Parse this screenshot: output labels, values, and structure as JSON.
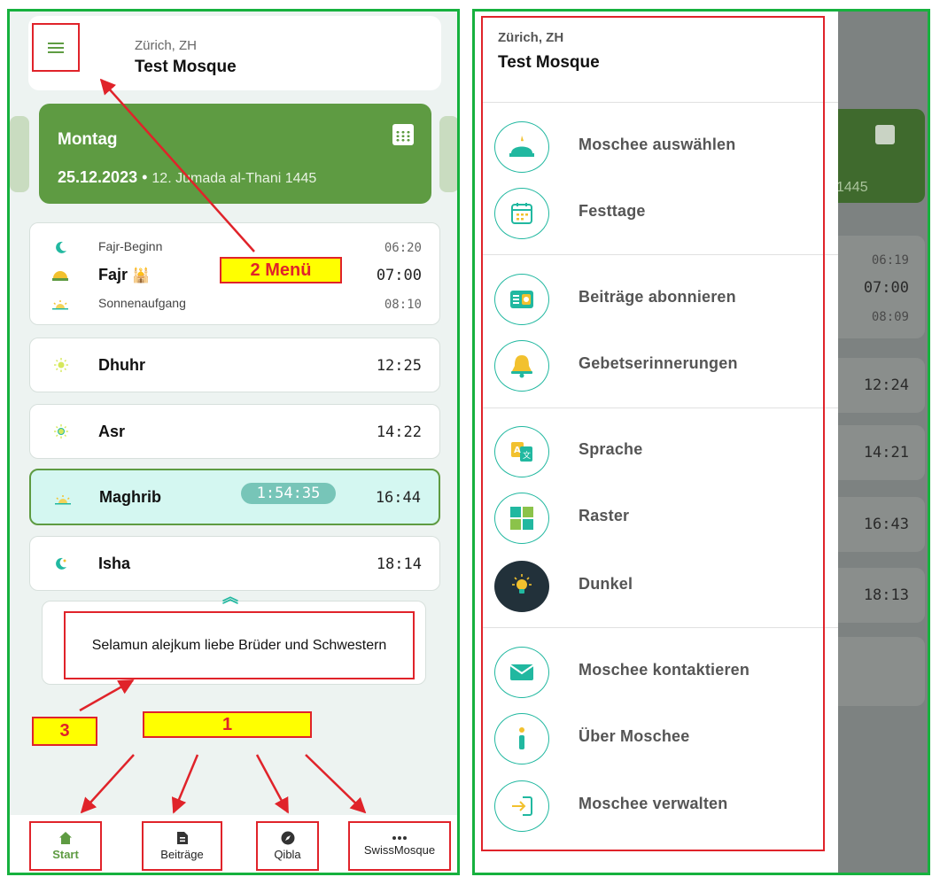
{
  "left": {
    "header": {
      "city": "Zürich, ZH",
      "mosque": "Test Mosque"
    },
    "date": {
      "day": "Montag",
      "gregorian": "25.12.2023",
      "separator": " • ",
      "hijri": "12. Jumada al-Thani 1445"
    },
    "fajr": {
      "begin_label": "Fajr-Beginn",
      "begin_time": "06:20",
      "name": "Fajr",
      "time": "07:00",
      "sunrise_label": "Sonnenaufgang",
      "sunrise_time": "08:10"
    },
    "prayers": [
      {
        "name": "Dhuhr",
        "time": "12:25",
        "icon": "sun-icon"
      },
      {
        "name": "Asr",
        "time": "14:22",
        "icon": "sun-icon"
      },
      {
        "name": "Maghrib",
        "time": "16:44",
        "icon": "sunset-icon",
        "countdown": "1:54:35",
        "active": true
      },
      {
        "name": "Isha",
        "time": "18:14",
        "icon": "moon-icon"
      }
    ],
    "chevron": "︽",
    "message": "Selamun alejkum liebe Brüder und Schwestern",
    "nav": [
      {
        "label": "Start",
        "icon": "home-icon",
        "active": true
      },
      {
        "label": "Beiträge",
        "icon": "document-icon"
      },
      {
        "label": "Qibla",
        "icon": "compass-icon"
      },
      {
        "label": "SwissMosque",
        "icon": "more-icon"
      }
    ]
  },
  "callouts": {
    "menu": "2 Menü",
    "nav": "1",
    "message": "3"
  },
  "right": {
    "drawer": {
      "city": "Zürich, ZH",
      "mosque": "Test Mosque",
      "items": [
        {
          "label": "Moschee auswählen",
          "icon": "mosque-icon"
        },
        {
          "label": "Festtage",
          "icon": "calendar-icon"
        },
        {
          "label": "Beiträge abonnieren",
          "icon": "subscribe-icon"
        },
        {
          "label": "Gebetserinnerungen",
          "icon": "bell-icon"
        },
        {
          "label": "Sprache",
          "icon": "translate-icon"
        },
        {
          "label": "Raster",
          "icon": "grid-icon"
        },
        {
          "label": "Dunkel",
          "icon": "lightbulb-icon"
        },
        {
          "label": "Moschee kontaktieren",
          "icon": "mail-icon"
        },
        {
          "label": "Über Moschee",
          "icon": "info-icon"
        },
        {
          "label": "Moschee verwalten",
          "icon": "login-icon"
        }
      ]
    },
    "background": {
      "hijri_fragment": "1445",
      "times": [
        "06:19",
        "07:00",
        "08:09",
        "12:24",
        "14:21",
        "16:43",
        "18:13"
      ]
    }
  },
  "colors": {
    "primary_green": "#5e9b42",
    "teal": "#21b8a0",
    "highlight_bg": "#d4f7f1",
    "annotation_red": "#e0232a",
    "annotation_yellow": "#ffff00",
    "frame_green": "#16b13e"
  }
}
